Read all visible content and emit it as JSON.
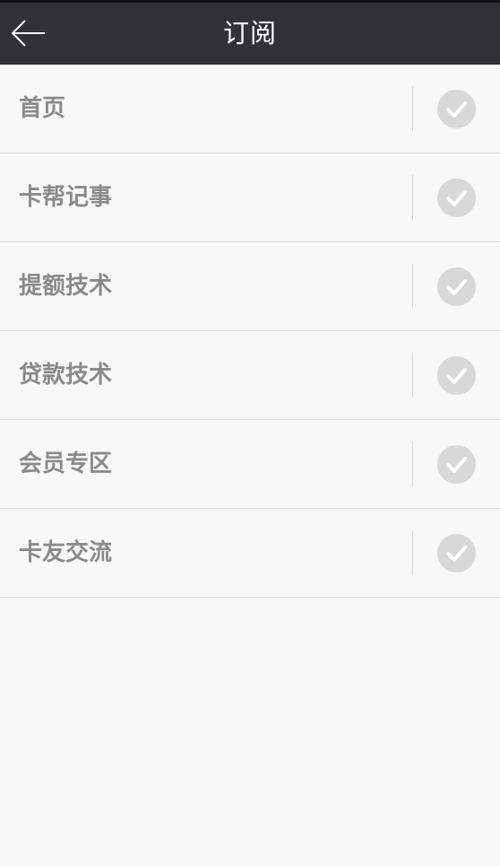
{
  "header": {
    "title": "订阅",
    "back_icon": "arrow-left-icon"
  },
  "subscriptions": [
    {
      "label": "首页",
      "checked_icon": "check-circle-icon"
    },
    {
      "label": "卡帮记事",
      "checked_icon": "check-circle-icon"
    },
    {
      "label": "提额技术",
      "checked_icon": "check-circle-icon"
    },
    {
      "label": "贷款技术",
      "checked_icon": "check-circle-icon"
    },
    {
      "label": "会员专区",
      "checked_icon": "check-circle-icon"
    },
    {
      "label": "卡友交流",
      "checked_icon": "check-circle-icon"
    }
  ],
  "colors": {
    "header_bg": "#323236",
    "page_bg": "#f8f8f8",
    "label_text": "#8a8a8a",
    "check_bg": "#d8d8d8"
  }
}
